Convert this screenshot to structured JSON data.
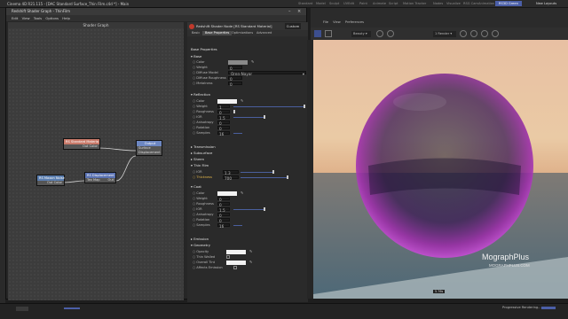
{
  "app": {
    "window_title": "Cinema 4D R21.115 - [DAC Standard Surface_Thin Film.c4d *] - Main",
    "layouts": [
      "Standard",
      "Model",
      "Sculpt",
      "UVEdit",
      "Paint",
      "Animate",
      "Script",
      "Motion Tracker",
      "Nodes",
      "Visualize",
      "RSG Cam",
      "Animation",
      "RS3D Green"
    ],
    "active_layout": "RS3D Green",
    "new_layouts": "New Layouts"
  },
  "dialog": {
    "title": "Redshift Shader Graph - ThinFilm",
    "menu": [
      "Edit",
      "View",
      "Tools",
      "Options",
      "Help"
    ],
    "graph_header": "Shader Graph"
  },
  "nodes": {
    "standard": {
      "title": "RS Standard Materia",
      "port": "Out Color"
    },
    "output": {
      "title": "Output",
      "ports": [
        "Surface",
        "Displacement"
      ]
    },
    "texture": {
      "title": "RS Maxon Noise",
      "port": "Out Color"
    },
    "displacement": {
      "title": "RS Displacement",
      "in_port": "Tex Map",
      "out_port": "Out"
    }
  },
  "props": {
    "header": "Redshift Shader Node [RS Standard Material]",
    "custom": "Custom",
    "tabs": [
      "Basic",
      "Base Properties",
      "Optimizations",
      "Advanced"
    ],
    "active_tab": "Base Properties",
    "section_title": "Base Properties",
    "base": {
      "heading": "Base",
      "color": "Color",
      "weight": "Weight",
      "weight_val": "0",
      "diffuse_model": "Diffuse Model",
      "diffuse_model_val": "Oren-Nayar",
      "diffuse_roughness": "Diffuse Roughness",
      "diffuse_roughness_val": "0",
      "metalness": "Metalness",
      "metalness_val": "0"
    },
    "reflection": {
      "heading": "Reflection",
      "color": "Color",
      "weight": "Weight",
      "weight_val": "1",
      "roughness": "Roughness",
      "roughness_val": "0",
      "ior": "IOR",
      "ior_val": "1.5",
      "anisotropy": "Anisotropy",
      "anisotropy_val": "0",
      "rotation": "Rotation",
      "rotation_val": "0",
      "samples": "Samples",
      "samples_val": "16"
    },
    "transmission": "Transmission",
    "subsurface": "Subsurface",
    "sheen": "Sheen",
    "thin_film": {
      "heading": "Thin Film",
      "ior": "IOR",
      "ior_val": "1.3",
      "thickness": "Thickness",
      "thickness_val": "700"
    },
    "coat": {
      "heading": "Coat",
      "color": "Color",
      "weight": "Weight",
      "weight_val": "0",
      "roughness": "Roughness",
      "roughness_val": "0",
      "ior": "IOR",
      "ior_val": "1.5",
      "anisotropy": "Anisotropy",
      "anisotropy_val": "0",
      "rotation": "Rotation",
      "rotation_val": "0",
      "samples": "Samples",
      "samples_val": "16"
    },
    "emission": "Emission",
    "geometry": {
      "heading": "Geometry",
      "opacity": "Opacity",
      "thin_walled": "Thin Walled",
      "overall_tint": "Overall Tint",
      "affects_emission": "Affects Emission"
    }
  },
  "viewport": {
    "menu": [
      "File",
      "View",
      "Preferences"
    ],
    "mode_value": "Beauty",
    "camera_value": "1 Render",
    "render_time": "5.76s",
    "watermark_title": "MographPlus",
    "watermark_url": "MOGRAPHPLUS.COM"
  },
  "status": {
    "text": "Progressive Rendering..."
  },
  "colors": {
    "accent": "#4b5fa8",
    "node_material": "#c97a6a",
    "node_output": "#6d87c2",
    "node_texture": "#5c7fb0",
    "node_displacement": "#5a72b2",
    "wire": "#d2d2d2"
  }
}
